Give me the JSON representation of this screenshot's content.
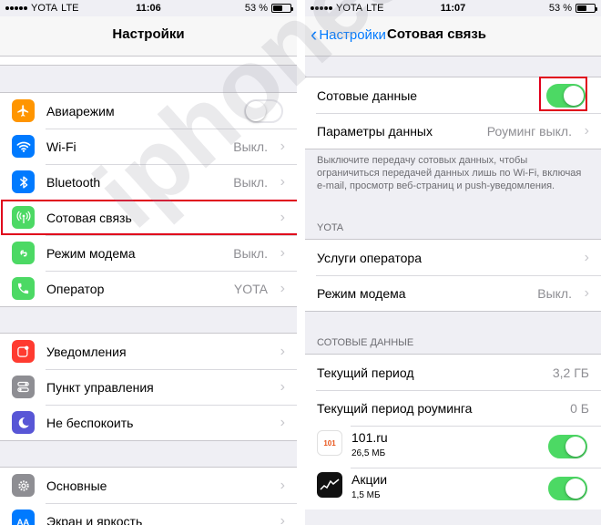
{
  "left": {
    "status": {
      "carrier": "YOTA",
      "network": "LTE",
      "time": "11:06",
      "battery": "53 %"
    },
    "title": "Настройки",
    "groups": [
      [
        {
          "label": "Авиарежим",
          "icon": "airplane-icon",
          "color": "#ff9500",
          "toggle": false
        },
        {
          "label": "Wi-Fi",
          "icon": "wifi-icon",
          "color": "#007aff",
          "value": "Выкл."
        },
        {
          "label": "Bluetooth",
          "icon": "bluetooth-icon",
          "color": "#007aff",
          "value": "Выкл."
        },
        {
          "label": "Сотовая связь",
          "icon": "antenna-icon",
          "color": "#4cd964",
          "value": ""
        },
        {
          "label": "Режим модема",
          "icon": "hotspot-icon",
          "color": "#4cd964",
          "value": "Выкл."
        },
        {
          "label": "Оператор",
          "icon": "phone-icon",
          "color": "#4cd964",
          "value": "YOTA"
        }
      ],
      [
        {
          "label": "Уведомления",
          "icon": "notifications-icon",
          "color": "#ff3b30"
        },
        {
          "label": "Пункт управления",
          "icon": "control-center-icon",
          "color": "#8e8e93"
        },
        {
          "label": "Не беспокоить",
          "icon": "moon-icon",
          "color": "#5856d6"
        }
      ],
      [
        {
          "label": "Основные",
          "icon": "gear-icon",
          "color": "#8e8e93"
        },
        {
          "label": "Экран и яркость",
          "icon": "display-icon",
          "color": "#007aff"
        }
      ]
    ]
  },
  "right": {
    "status": {
      "carrier": "YOTA",
      "network": "LTE",
      "time": "11:07",
      "battery": "53 %"
    },
    "back_label": "Настройки",
    "title": "Сотовая связь",
    "cellular_data": {
      "label": "Сотовые данные",
      "toggle": true
    },
    "data_options": {
      "label": "Параметры данных",
      "value": "Роуминг выкл."
    },
    "note": "Выключите передачу сотовых данных, чтобы ограничиться передачей данных лишь по Wi-Fi, включая e-mail, просмотр веб-страниц и push-уведомления.",
    "carrier_header": "YOTA",
    "carrier_rows": [
      {
        "label": "Услуги оператора",
        "value": ""
      },
      {
        "label": "Режим модема",
        "value": "Выкл."
      }
    ],
    "usage_header": "СОТОВЫЕ ДАННЫЕ",
    "usage_rows": [
      {
        "label": "Текущий период",
        "value": "3,2 ГБ"
      },
      {
        "label": "Текущий период роуминга",
        "value": "0 Б"
      }
    ],
    "apps": [
      {
        "name": "101.ru",
        "size": "26,5 МБ",
        "icon_text": "101",
        "toggle": true
      },
      {
        "name": "Акции",
        "size": "1,5 МБ",
        "icon_text": "",
        "toggle": true
      }
    ]
  },
  "watermark": "iphones.ru",
  "colors": {
    "accent": "#007aff",
    "toggle_on": "#4cd964",
    "highlight": "#e0001b"
  }
}
